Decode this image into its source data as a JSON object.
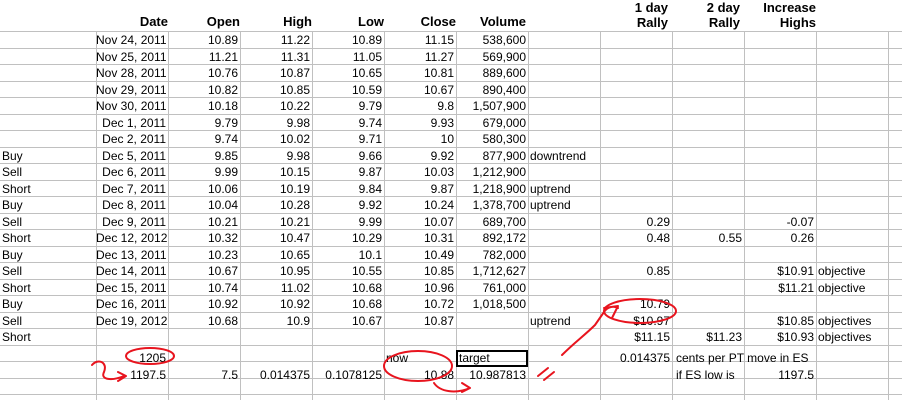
{
  "headers": {
    "date": "Date",
    "open": "Open",
    "high": "High",
    "low": "Low",
    "close": "Close",
    "volume": "Volume",
    "rally1_line1": "1 day",
    "rally1_line2": "Rally",
    "rally2_line1": "2 day",
    "rally2_line2": "Rally",
    "inc_line1": "Increase",
    "inc_line2": "Highs"
  },
  "rows": [
    {
      "label": "",
      "date": "Nov 24, 2011",
      "open": "10.89",
      "high": "11.22",
      "low": "10.89",
      "close": "11.15",
      "volume": "538,600",
      "note": "",
      "r1": "",
      "r2": "",
      "inc": "",
      "obj": ""
    },
    {
      "label": "",
      "date": "Nov 25, 2011",
      "open": "11.21",
      "high": "11.31",
      "low": "11.05",
      "close": "11.27",
      "volume": "569,900",
      "note": "",
      "r1": "",
      "r2": "",
      "inc": "",
      "obj": ""
    },
    {
      "label": "",
      "date": "Nov 28, 2011",
      "open": "10.76",
      "high": "10.87",
      "low": "10.65",
      "close": "10.81",
      "volume": "889,600",
      "note": "",
      "r1": "",
      "r2": "",
      "inc": "",
      "obj": ""
    },
    {
      "label": "",
      "date": "Nov 29, 2011",
      "open": "10.82",
      "high": "10.85",
      "low": "10.59",
      "close": "10.67",
      "volume": "890,400",
      "note": "",
      "r1": "",
      "r2": "",
      "inc": "",
      "obj": ""
    },
    {
      "label": "",
      "date": "Nov 30, 2011",
      "open": "10.18",
      "high": "10.22",
      "low": "9.79",
      "close": "9.8",
      "volume": "1,507,900",
      "note": "",
      "r1": "",
      "r2": "",
      "inc": "",
      "obj": ""
    },
    {
      "label": "",
      "date": "Dec 1, 2011",
      "open": "9.79",
      "high": "9.98",
      "low": "9.74",
      "close": "9.93",
      "volume": "679,000",
      "note": "",
      "r1": "",
      "r2": "",
      "inc": "",
      "obj": ""
    },
    {
      "label": "",
      "date": "Dec 2, 2011",
      "open": "9.74",
      "high": "10.02",
      "low": "9.71",
      "close": "10",
      "volume": "580,300",
      "note": "",
      "r1": "",
      "r2": "",
      "inc": "",
      "obj": ""
    },
    {
      "label": "Buy",
      "date": "Dec 5, 2011",
      "open": "9.85",
      "high": "9.98",
      "low": "9.66",
      "close": "9.92",
      "volume": "877,900",
      "note": "downtrend",
      "r1": "",
      "r2": "",
      "inc": "",
      "obj": ""
    },
    {
      "label": "Sell",
      "date": "Dec 6, 2011",
      "open": "9.99",
      "high": "10.15",
      "low": "9.87",
      "close": "10.03",
      "volume": "1,212,900",
      "note": "",
      "r1": "",
      "r2": "",
      "inc": "",
      "obj": ""
    },
    {
      "label": "Short",
      "date": "Dec 7, 2011",
      "open": "10.06",
      "high": "10.19",
      "low": "9.84",
      "close": "9.87",
      "volume": "1,218,900",
      "note": "uptrend",
      "r1": "",
      "r2": "",
      "inc": "",
      "obj": ""
    },
    {
      "label": "Buy",
      "date": "Dec 8, 2011",
      "open": "10.04",
      "high": "10.28",
      "low": "9.92",
      "close": "10.24",
      "volume": "1,378,700",
      "note": "uptrend",
      "r1": "",
      "r2": "",
      "inc": "",
      "obj": ""
    },
    {
      "label": "Sell",
      "date": "Dec 9, 2011",
      "open": "10.21",
      "high": "10.21",
      "low": "9.99",
      "close": "10.07",
      "volume": "689,700",
      "note": "",
      "r1": "0.29",
      "r2": "",
      "inc": "-0.07",
      "obj": ""
    },
    {
      "label": "Short",
      "date": "Dec 12, 2012",
      "open": "10.32",
      "high": "10.47",
      "low": "10.29",
      "close": "10.31",
      "volume": "892,172",
      "note": "",
      "r1": "0.48",
      "r2": "0.55",
      "inc": "0.26",
      "obj": ""
    },
    {
      "label": "Buy",
      "date": "Dec 13, 2011",
      "open": "10.23",
      "high": "10.65",
      "low": "10.1",
      "close": "10.49",
      "volume": "782,000",
      "note": "",
      "r1": "",
      "r2": "",
      "inc": "",
      "obj": ""
    },
    {
      "label": "Sell",
      "date": "Dec 14, 2011",
      "open": "10.67",
      "high": "10.95",
      "low": "10.55",
      "close": "10.85",
      "volume": "1,712,627",
      "note": "",
      "r1": "0.85",
      "r2": "",
      "inc": "$10.91",
      "obj": "objective"
    },
    {
      "label": "Short",
      "date": "Dec 15, 2011",
      "open": "10.74",
      "high": "11.02",
      "low": "10.68",
      "close": "10.96",
      "volume": "761,000",
      "note": "",
      "r1": "",
      "r2": "",
      "inc": "$11.21",
      "obj": "objective"
    },
    {
      "label": "Buy",
      "date": "Dec 16, 2011",
      "open": "10.92",
      "high": "10.92",
      "low": "10.68",
      "close": "10.72",
      "volume": "1,018,500",
      "note": "",
      "r1": "10.79",
      "r2": "",
      "inc": "",
      "obj": ""
    },
    {
      "label": "Sell",
      "date": "Dec 19, 2012",
      "open": "10.68",
      "high": "10.9",
      "low": "10.67",
      "close": "10.87",
      "volume": "",
      "note": "uptrend",
      "r1": "$10.97",
      "r2": "",
      "inc": "$10.85",
      "obj": "objectives"
    },
    {
      "label": "Short",
      "date": "",
      "open": "",
      "high": "",
      "low": "",
      "close": "",
      "volume": "",
      "note": "",
      "r1": "$11.15",
      "r2": "$11.23",
      "inc": "$10.93",
      "obj": "objectives"
    }
  ],
  "calc": {
    "row1": {
      "b": "1205",
      "close_text": "now",
      "vol_text": "target",
      "r1": "0.014375",
      "r2_text": "cents per PT move in ES"
    },
    "row2": {
      "b": "1197.5",
      "open": "7.5",
      "high": "0.014375",
      "low": "0.1078125",
      "close": "10.88",
      "volume": "10.987813",
      "r2_text": "if ES low is",
      "inc": "1197.5"
    }
  },
  "annotation_color": "#e8141e"
}
